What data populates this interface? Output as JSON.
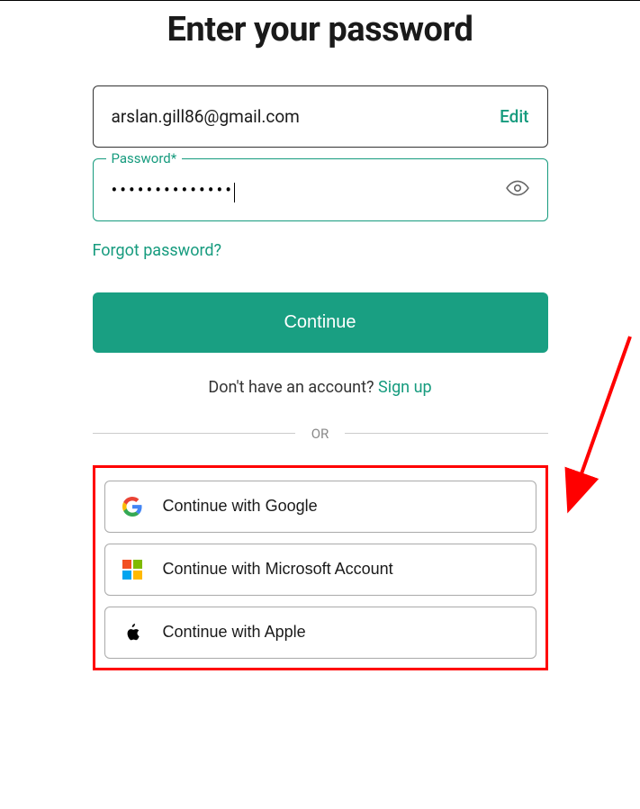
{
  "title": "Enter your password",
  "email": {
    "value": "arslan.gill86@gmail.com",
    "edit_label": "Edit"
  },
  "password": {
    "label": "Password*",
    "mask": "••••••••••••••",
    "value_masked": true
  },
  "forgot_label": "Forgot password?",
  "continue_label": "Continue",
  "signup": {
    "prompt": "Don't have an account?",
    "link": "Sign up"
  },
  "divider_label": "OR",
  "social": {
    "google_label": "Continue with Google",
    "microsoft_label": "Continue with Microsoft Account",
    "apple_label": "Continue with Apple"
  },
  "colors": {
    "accent": "#169b7e",
    "button": "#199f82",
    "highlight_border": "#f00"
  }
}
